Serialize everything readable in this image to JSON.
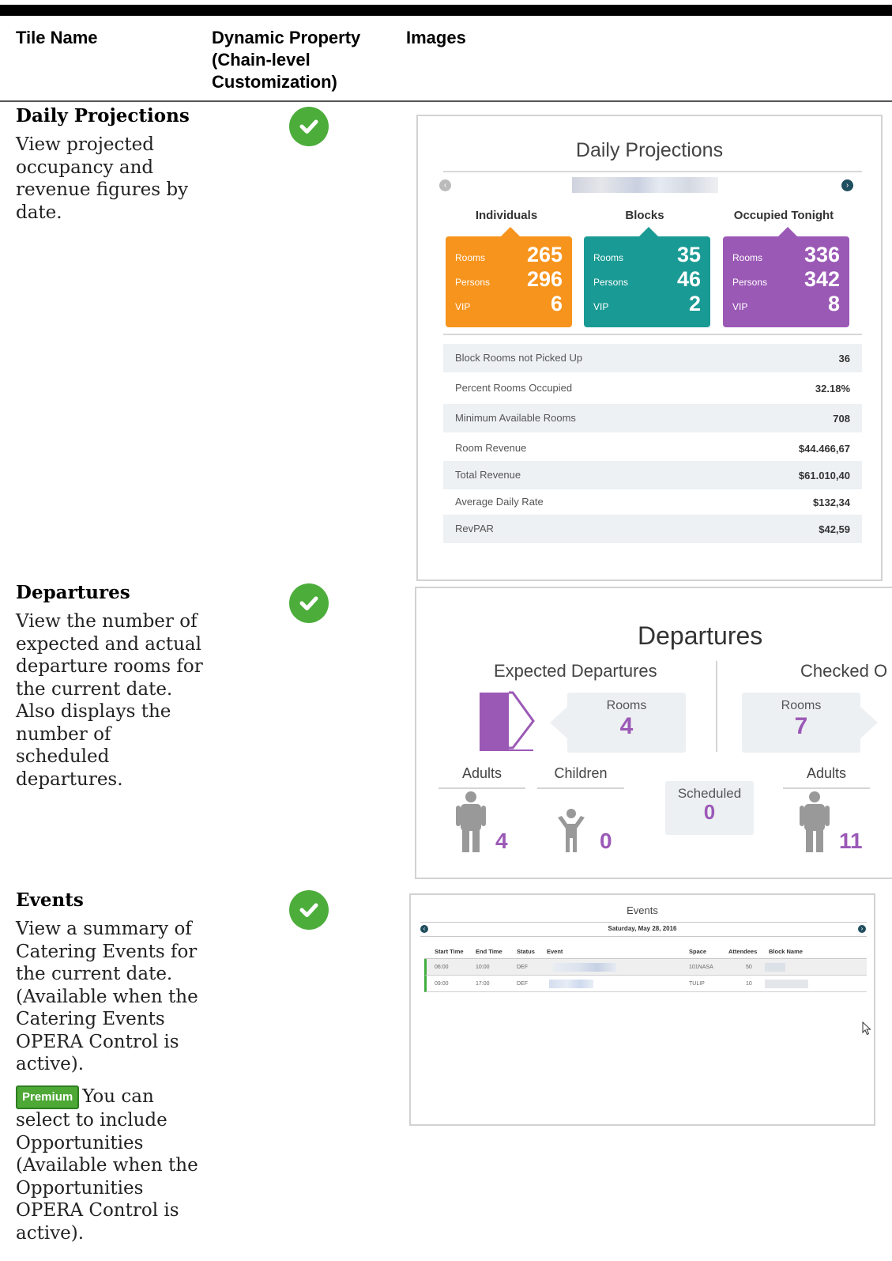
{
  "header": {
    "tile_name": "Tile Name",
    "dynamic_property": "Dynamic Property (Chain-level Customization)",
    "images": "Images"
  },
  "tiles": [
    {
      "name": "Daily Projections",
      "description": "View projected occupancy and revenue figures by date."
    },
    {
      "name": "Departures",
      "description": "View the number of expected and actual departure rooms for the current date. Also displays the number of scheduled departures."
    },
    {
      "name": "Events",
      "description": "View a summary of Catering Events for the current date. (Available when the Catering Events OPERA Control is active).",
      "premium_badge": "Premium",
      "premium_note": "You can select to include Opportunities (Available when the Opportunities OPERA Control is active)."
    }
  ],
  "daily_projections": {
    "title": "Daily Projections",
    "columns": [
      {
        "heading": "Individuals",
        "color": "#f7941d",
        "rooms": "265",
        "persons": "296",
        "vip": "6"
      },
      {
        "heading": "Blocks",
        "color": "#1a9a94",
        "rooms": "35",
        "persons": "46",
        "vip": "2"
      },
      {
        "heading": "Occupied Tonight",
        "color": "#9b59b6",
        "rooms": "336",
        "persons": "342",
        "vip": "8"
      }
    ],
    "labels": {
      "rooms": "Rooms",
      "persons": "Persons",
      "vip": "VIP"
    },
    "stats": [
      {
        "label": "Block Rooms not Picked Up",
        "value": "36"
      },
      {
        "label": "Percent Rooms Occupied",
        "value": "32.18%"
      },
      {
        "label": "Minimum Available Rooms",
        "value": "708"
      },
      {
        "label": "Room Revenue",
        "value": "$44.466,67"
      },
      {
        "label": "Total Revenue",
        "value": "$61.010,40"
      },
      {
        "label": "Average Daily Rate",
        "value": "$132,34"
      },
      {
        "label": "RevPAR",
        "value": "$42,59"
      }
    ]
  },
  "departures": {
    "title": "Departures",
    "expected": {
      "heading": "Expected Departures",
      "rooms_label": "Rooms",
      "rooms": "4"
    },
    "checked": {
      "heading": "Checked O",
      "rooms_label": "Rooms",
      "rooms": "7"
    },
    "cols": {
      "adults": "Adults",
      "children": "Children",
      "adults2": "Adults"
    },
    "scheduled": {
      "label": "Scheduled",
      "value": "0"
    },
    "counts": {
      "adults": "4",
      "children": "0",
      "adults2": "11"
    }
  },
  "events": {
    "title": "Events",
    "date": "Saturday, May 28, 2016",
    "columns": [
      "Start Time",
      "End Time",
      "Status",
      "Event",
      "Space",
      "Attendees",
      "Block Name"
    ],
    "rows": [
      {
        "start": "06:00",
        "end": "10:00",
        "status": "DEF",
        "space": "101NASA",
        "attendees": "50"
      },
      {
        "start": "09:00",
        "end": "17:00",
        "status": "DEF",
        "space": "TULIP",
        "attendees": "10"
      }
    ]
  },
  "colors": {
    "check": "#4cad3b",
    "accent_purple": "#9b59b6",
    "orange": "#f7941d",
    "teal": "#1a9a94"
  }
}
